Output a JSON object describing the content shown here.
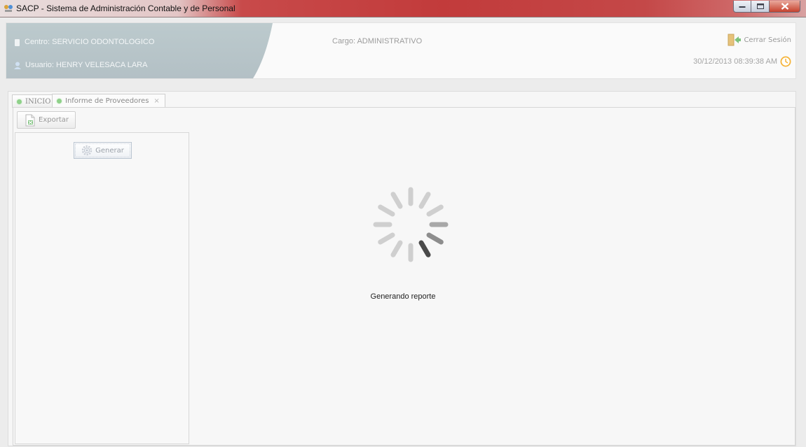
{
  "window": {
    "title": "SACP - Sistema de Administración Contable y de Personal",
    "icon": "app-icon",
    "controls": [
      "minimize-icon",
      "maximize-icon",
      "close-icon"
    ]
  },
  "header": {
    "centro_label": "Centro: SERVICIO ODONTOLOGICO",
    "usuario_label": "Usuario: HENRY VELESACA LARA",
    "cargo_label": "Cargo:  ADMINISTRATIVO",
    "logout_label": "Cerrar Sesión",
    "datetime": "30/12/2013 08:39:38 AM",
    "icons": [
      "building-icon",
      "user-icon",
      "logout-door-icon",
      "clock-icon"
    ]
  },
  "tabs": [
    {
      "label": "INICIO",
      "active": false,
      "closable": false
    },
    {
      "label": "Informe de Proveedores",
      "active": true,
      "closable": true,
      "close_glyph": "×"
    }
  ],
  "toolbar": {
    "export_label": "Exportar",
    "export_icon": "excel-export-icon"
  },
  "left_panel": {
    "generate_label": "Generar",
    "generate_icon": "gear-icon"
  },
  "loading": {
    "text": "Generando reporte",
    "icon": "loading-spinner-icon"
  },
  "colors": {
    "titlebar_accent": "#c23b3b",
    "header_user_panel": "#b8c5ca",
    "tab_dot": "#8fd18a",
    "clock_accent": "#f5b43a"
  }
}
